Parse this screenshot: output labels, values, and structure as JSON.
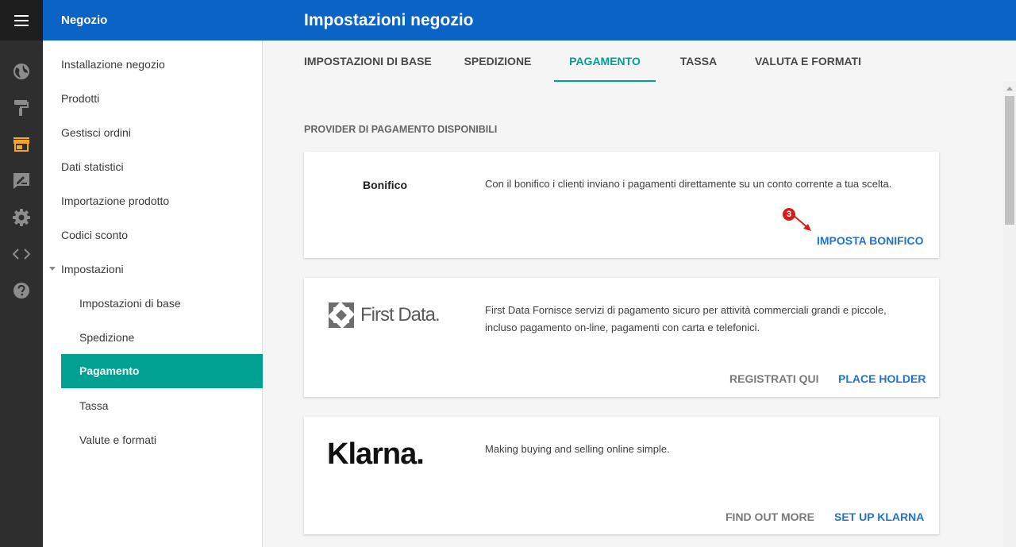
{
  "header": {
    "store_name": "Negozio",
    "page_title": "Impostazioni negozio"
  },
  "rail": {
    "icons": [
      "menu-icon",
      "globe-icon",
      "paint-roller-icon",
      "store-icon",
      "edit-note-icon",
      "gear-icon",
      "code-icon",
      "help-icon"
    ],
    "active_color": "#f5a623"
  },
  "sidebar": {
    "items": [
      {
        "label": "Installazione negozio"
      },
      {
        "label": "Prodotti"
      },
      {
        "label": "Gestisci ordini"
      },
      {
        "label": "Dati statistici"
      },
      {
        "label": "Importazione prodotto"
      },
      {
        "label": "Codici sconto"
      },
      {
        "label": "Impostazioni"
      }
    ],
    "sub_items": [
      {
        "label": "Impostazioni di base"
      },
      {
        "label": "Spedizione"
      },
      {
        "label": "Pagamento"
      },
      {
        "label": "Tassa"
      },
      {
        "label": "Valute e formati"
      }
    ],
    "active_sub": "Pagamento"
  },
  "tabs": [
    {
      "label": "IMPOSTAZIONI DI BASE"
    },
    {
      "label": "SPEDIZIONE"
    },
    {
      "label": "PAGAMENTO"
    },
    {
      "label": "TASSA"
    },
    {
      "label": "VALUTA E FORMATI"
    }
  ],
  "main": {
    "section_title": "PROVIDER DI PAGAMENTO DISPONIBILI",
    "step_number": "3",
    "providers": [
      {
        "name": "Bonifico",
        "description": "Con il bonifico i clienti inviano i pagamenti direttamente su un conto corrente a tua scelta.",
        "primary_action": "IMPOSTA BONIFICO"
      },
      {
        "logo_text": "First Data.",
        "description": "First Data Fornisce servizi di pagamento sicuro per attività commerciali grandi e piccole, incluso pagamento on-line, pagamenti con carta e telefonici.",
        "secondary_action": "REGISTRATI QUI",
        "primary_action": "PLACE HOLDER"
      },
      {
        "logo_text": "Klarna.",
        "description": "Making buying and selling online simple.",
        "secondary_action": "FIND OUT MORE",
        "primary_action": "SET UP KLARNA"
      }
    ]
  },
  "colors": {
    "header_blue": "#0b63c5",
    "accent_teal": "#00a092",
    "link_blue": "#1f74d0",
    "marker_red": "#d71b1b"
  }
}
